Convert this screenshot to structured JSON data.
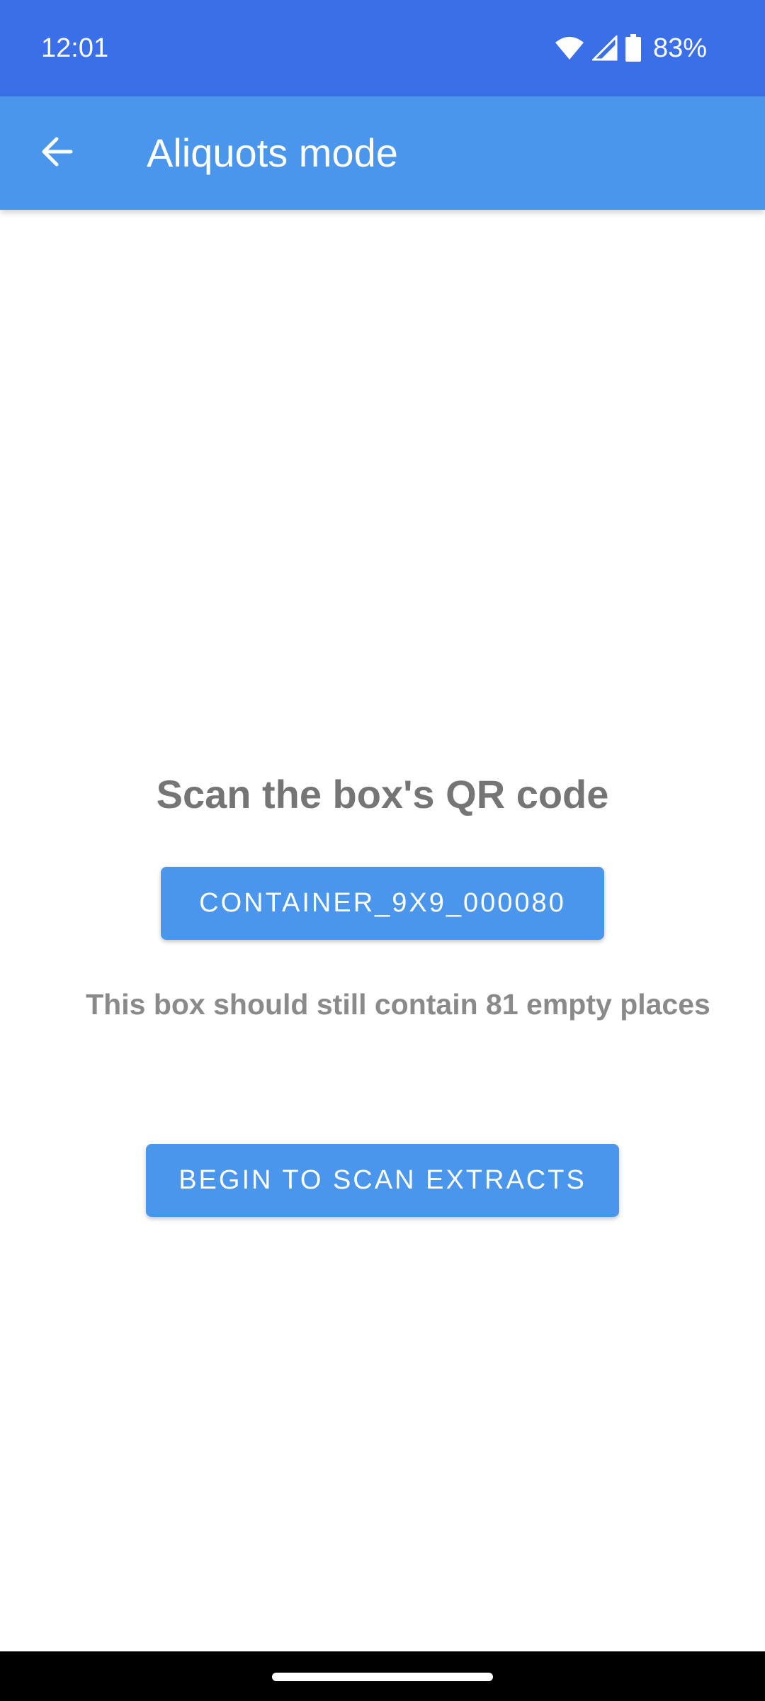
{
  "status_bar": {
    "time": "12:01",
    "battery_percent": "83%",
    "icons": [
      "wifi-icon",
      "cell-signal-icon",
      "battery-icon"
    ]
  },
  "app_bar": {
    "title": "Aliquots mode",
    "back_icon": "arrow-left-icon"
  },
  "main": {
    "scan_title": "Scan the box's QR code",
    "container_button_label": "CONTAINER_9X9_000080",
    "hint": "This box should still contain 81 empty places",
    "begin_button_label": "BEGIN TO SCAN EXTRACTS"
  },
  "colors": {
    "status_bar": "#3a6fe8",
    "app_bar": "#4a96ec",
    "button": "#4a96ec",
    "text_gray": "#757575"
  }
}
